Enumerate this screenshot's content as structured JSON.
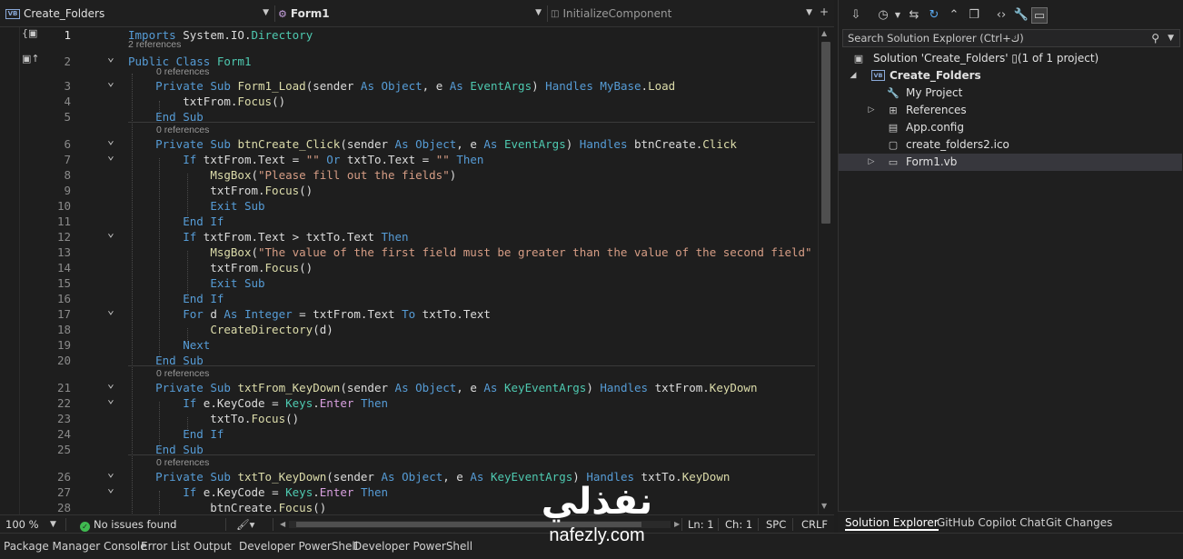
{
  "navbar": {
    "project_dropdown": "Create_Folders",
    "class_dropdown": "Form1",
    "member_dropdown": "InitializeComponent"
  },
  "editor": {
    "references": {
      "r2": "2 references",
      "r3": "0 references",
      "r6": "0 references",
      "r21": "0 references",
      "r26": "0 references"
    },
    "line_numbers": [
      "1",
      "2",
      "3",
      "4",
      "5",
      "6",
      "7",
      "8",
      "9",
      "10",
      "11",
      "12",
      "13",
      "14",
      "15",
      "16",
      "17",
      "18",
      "19",
      "20",
      "21",
      "22",
      "23",
      "24",
      "25",
      "26",
      "27",
      "28"
    ],
    "lines": [
      [
        [
          "kw",
          "Imports"
        ],
        [
          "id",
          " System.IO."
        ],
        [
          "ty",
          "Directory"
        ]
      ],
      [
        [
          "kw",
          "Public Class"
        ],
        [
          "id",
          " "
        ],
        [
          "ty",
          "Form1"
        ]
      ],
      [
        [
          "id",
          "    "
        ],
        [
          "kw",
          "Private Sub"
        ],
        [
          "id",
          " "
        ],
        [
          "fn",
          "Form1_Load"
        ],
        [
          "id",
          "(sender "
        ],
        [
          "kw",
          "As"
        ],
        [
          "id",
          " "
        ],
        [
          "kw",
          "Object"
        ],
        [
          "id",
          ", e "
        ],
        [
          "kw",
          "As"
        ],
        [
          "id",
          " "
        ],
        [
          "ty",
          "EventArgs"
        ],
        [
          "id",
          ") "
        ],
        [
          "kw",
          "Handles"
        ],
        [
          "id",
          " "
        ],
        [
          "kw",
          "MyBase"
        ],
        [
          "id",
          "."
        ],
        [
          "fn",
          "Load"
        ]
      ],
      [
        [
          "id",
          "        txtFrom."
        ],
        [
          "fn",
          "Focus"
        ],
        [
          "id",
          "()"
        ]
      ],
      [
        [
          "id",
          "    "
        ],
        [
          "kw",
          "End Sub"
        ]
      ],
      [
        [
          "id",
          "    "
        ],
        [
          "kw",
          "Private Sub"
        ],
        [
          "id",
          " "
        ],
        [
          "fn",
          "btnCreate_Click"
        ],
        [
          "id",
          "(sender "
        ],
        [
          "kw",
          "As"
        ],
        [
          "id",
          " "
        ],
        [
          "kw",
          "Object"
        ],
        [
          "id",
          ", e "
        ],
        [
          "kw",
          "As"
        ],
        [
          "id",
          " "
        ],
        [
          "ty",
          "EventArgs"
        ],
        [
          "id",
          ") "
        ],
        [
          "kw",
          "Handles"
        ],
        [
          "id",
          " btnCreate."
        ],
        [
          "fn",
          "Click"
        ]
      ],
      [
        [
          "id",
          "        "
        ],
        [
          "kw",
          "If"
        ],
        [
          "id",
          " txtFrom.Text = "
        ],
        [
          "st",
          "\"\""
        ],
        [
          "id",
          " "
        ],
        [
          "kw",
          "Or"
        ],
        [
          "id",
          " txtTo.Text = "
        ],
        [
          "st",
          "\"\""
        ],
        [
          "id",
          " "
        ],
        [
          "kw",
          "Then"
        ]
      ],
      [
        [
          "id",
          "            "
        ],
        [
          "fn",
          "MsgBox"
        ],
        [
          "id",
          "("
        ],
        [
          "st",
          "\"Please fill out the fields\""
        ],
        [
          "id",
          ")"
        ]
      ],
      [
        [
          "id",
          "            txtFrom."
        ],
        [
          "fn",
          "Focus"
        ],
        [
          "id",
          "()"
        ]
      ],
      [
        [
          "id",
          "            "
        ],
        [
          "kw",
          "Exit Sub"
        ]
      ],
      [
        [
          "id",
          "        "
        ],
        [
          "kw",
          "End If"
        ]
      ],
      [
        [
          "id",
          "        "
        ],
        [
          "kw",
          "If"
        ],
        [
          "id",
          " txtFrom.Text > txtTo.Text "
        ],
        [
          "kw",
          "Then"
        ]
      ],
      [
        [
          "id",
          "            "
        ],
        [
          "fn",
          "MsgBox"
        ],
        [
          "id",
          "("
        ],
        [
          "st",
          "\"The value of the first field must be greater than the value of the second field\""
        ]
      ],
      [
        [
          "id",
          "            txtFrom."
        ],
        [
          "fn",
          "Focus"
        ],
        [
          "id",
          "()"
        ]
      ],
      [
        [
          "id",
          "            "
        ],
        [
          "kw",
          "Exit Sub"
        ]
      ],
      [
        [
          "id",
          "        "
        ],
        [
          "kw",
          "End If"
        ]
      ],
      [
        [
          "id",
          "        "
        ],
        [
          "kw",
          "For"
        ],
        [
          "id",
          " d "
        ],
        [
          "kw",
          "As"
        ],
        [
          "id",
          " "
        ],
        [
          "kw",
          "Integer"
        ],
        [
          "id",
          " = txtFrom.Text "
        ],
        [
          "kw",
          "To"
        ],
        [
          "id",
          " txtTo.Text"
        ]
      ],
      [
        [
          "id",
          "            "
        ],
        [
          "fn",
          "CreateDirectory"
        ],
        [
          "id",
          "(d)"
        ]
      ],
      [
        [
          "id",
          "        "
        ],
        [
          "kw",
          "Next"
        ]
      ],
      [
        [
          "id",
          "    "
        ],
        [
          "kw",
          "End Sub"
        ]
      ],
      [
        [
          "id",
          "    "
        ],
        [
          "kw",
          "Private Sub"
        ],
        [
          "id",
          " "
        ],
        [
          "fn",
          "txtFrom_KeyDown"
        ],
        [
          "id",
          "(sender "
        ],
        [
          "kw",
          "As"
        ],
        [
          "id",
          " "
        ],
        [
          "kw",
          "Object"
        ],
        [
          "id",
          ", e "
        ],
        [
          "kw",
          "As"
        ],
        [
          "id",
          " "
        ],
        [
          "ty",
          "KeyEventArgs"
        ],
        [
          "id",
          ") "
        ],
        [
          "kw",
          "Handles"
        ],
        [
          "id",
          " txtFrom."
        ],
        [
          "fn",
          "KeyDown"
        ]
      ],
      [
        [
          "id",
          "        "
        ],
        [
          "kw",
          "If"
        ],
        [
          "id",
          " e.KeyCode = "
        ],
        [
          "ty",
          "Keys"
        ],
        [
          "id",
          "."
        ],
        [
          "ky",
          "Enter"
        ],
        [
          "id",
          " "
        ],
        [
          "kw",
          "Then"
        ]
      ],
      [
        [
          "id",
          "            txtTo."
        ],
        [
          "fn",
          "Focus"
        ],
        [
          "id",
          "()"
        ]
      ],
      [
        [
          "id",
          "        "
        ],
        [
          "kw",
          "End If"
        ]
      ],
      [
        [
          "id",
          "    "
        ],
        [
          "kw",
          "End Sub"
        ]
      ],
      [
        [
          "id",
          "    "
        ],
        [
          "kw",
          "Private Sub"
        ],
        [
          "id",
          " "
        ],
        [
          "fn",
          "txtTo_KeyDown"
        ],
        [
          "id",
          "(sender "
        ],
        [
          "kw",
          "As"
        ],
        [
          "id",
          " "
        ],
        [
          "kw",
          "Object"
        ],
        [
          "id",
          ", e "
        ],
        [
          "kw",
          "As"
        ],
        [
          "id",
          " "
        ],
        [
          "ty",
          "KeyEventArgs"
        ],
        [
          "id",
          ") "
        ],
        [
          "kw",
          "Handles"
        ],
        [
          "id",
          " txtTo."
        ],
        [
          "fn",
          "KeyDown"
        ]
      ],
      [
        [
          "id",
          "        "
        ],
        [
          "kw",
          "If"
        ],
        [
          "id",
          " e.KeyCode = "
        ],
        [
          "ty",
          "Keys"
        ],
        [
          "id",
          "."
        ],
        [
          "ky",
          "Enter"
        ],
        [
          "id",
          " "
        ],
        [
          "kw",
          "Then"
        ]
      ],
      [
        [
          "id",
          "            btnCreate."
        ],
        [
          "fn",
          "Focus"
        ],
        [
          "id",
          "()"
        ]
      ]
    ]
  },
  "editor_status": {
    "zoom": "100 %",
    "issues": "No issues found",
    "line": "Ln: 1",
    "char": "Ch: 1",
    "spacing": "SPC",
    "line_ending": "CRLF"
  },
  "solution_explorer": {
    "search_placeholder": "Search Solution Explorer (Ctrl+ك)",
    "tree": {
      "solution": "Solution 'Create_Folders' ▯(1 of 1 project)",
      "project": "Create_Folders",
      "my_project": "My Project",
      "references": "References",
      "app_config": "App.config",
      "ico_file": "create_folders2.ico",
      "form1": "Form1.vb"
    },
    "tabs": [
      "Solution Explorer",
      "GitHub Copilot Chat",
      "Git Changes"
    ]
  },
  "tool_tabs": [
    "Package Manager Console",
    "Error List",
    "Output",
    "Developer PowerShell",
    "Developer PowerShell"
  ],
  "watermark": {
    "arabic": "نفذلي",
    "latin": "nafezly.com"
  }
}
